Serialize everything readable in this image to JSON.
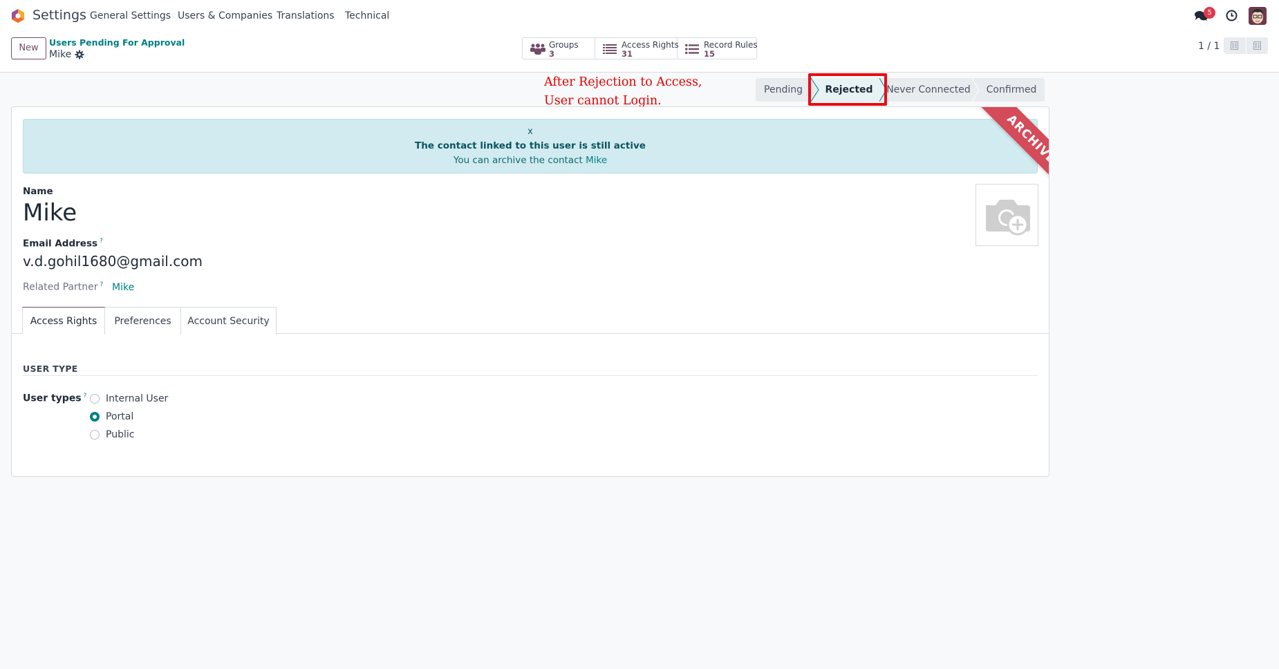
{
  "navbar": {
    "app_title": "Settings",
    "menu": [
      "General Settings",
      "Users & Companies",
      "Translations",
      "Technical"
    ],
    "messages_badge": "5",
    "icons": {
      "messages": "chat-bubbles-icon",
      "activity": "clock-icon",
      "avatar": "user-avatar"
    }
  },
  "control_panel": {
    "new_label": "New",
    "breadcrumb_parent": "Users Pending For Approval",
    "breadcrumb_current": "Mike",
    "smart_buttons": [
      {
        "label": "Groups",
        "value": "3",
        "icon": "users-icon"
      },
      {
        "label": "Access Rights",
        "value": "31",
        "icon": "list-icon"
      },
      {
        "label": "Record Rules",
        "value": "15",
        "icon": "bullet-list-icon"
      }
    ],
    "pager": "1 / 1"
  },
  "annotation": {
    "line1": "After Rejection to Access,",
    "line2": "User cannot Login.",
    "color": "#e00000"
  },
  "statusbar": {
    "stages": [
      "Pending",
      "Rejected",
      "Never Connected",
      "Confirmed"
    ],
    "active": "Rejected"
  },
  "form": {
    "alert": {
      "close": "x",
      "title": "The contact linked to this user is still active",
      "body_prefix": "You can archive the contact ",
      "body_link": "Mike"
    },
    "ribbon": "ARCHIVED",
    "name_label": "Name",
    "name_value": "Mike",
    "email_label": "Email Address",
    "email_value": "v.d.gohil1680@gmail.com",
    "help_mark": "?",
    "partner_label": "Related Partner",
    "partner_value": "Mike",
    "tabs": [
      "Access Rights",
      "Preferences",
      "Account Security"
    ],
    "active_tab": "Access Rights",
    "section_title": "USER TYPE",
    "user_types_label": "User types",
    "user_types": [
      {
        "label": "Internal User",
        "checked": false
      },
      {
        "label": "Portal",
        "checked": true
      },
      {
        "label": "Public",
        "checked": false
      }
    ]
  },
  "colors": {
    "brand": "#714b67",
    "accent": "#017e84",
    "ribbon": "#d44b5a",
    "highlight": "#ee0a12"
  }
}
